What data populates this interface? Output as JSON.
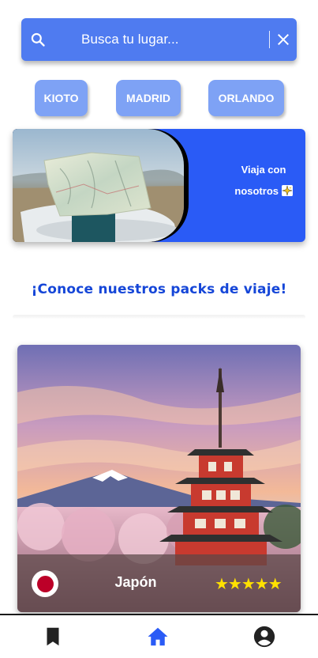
{
  "search": {
    "placeholder": "Busca tu lugar...",
    "search_icon": "search-icon",
    "clear_icon": "close-icon"
  },
  "cities": [
    {
      "label": "KIOTO"
    },
    {
      "label": "MADRID"
    },
    {
      "label": "ORLANDO"
    }
  ],
  "banner": {
    "line1": "Viaja con",
    "line2": "nosotros",
    "icon": "sparkles-icon",
    "image": "traveler-with-map-photo"
  },
  "section": {
    "heading": "¡Conoce nuestros packs de viaje!"
  },
  "card": {
    "country": "Japón",
    "rating": "★★★★★",
    "rating_value": 5,
    "flag": "japan-flag",
    "image": "mount-fuji-pagoda-photo"
  },
  "nav": {
    "items": [
      {
        "icon": "bookmark-icon"
      },
      {
        "icon": "home-icon",
        "active": true
      },
      {
        "icon": "account-icon"
      }
    ]
  },
  "colors": {
    "primary": "#2a5bf6",
    "search_bg": "#4f7bf0",
    "chip_bg": "#7ea2f5",
    "heading": "#1546d8",
    "active_nav": "#2a5bf6",
    "star": "#ffe100"
  }
}
